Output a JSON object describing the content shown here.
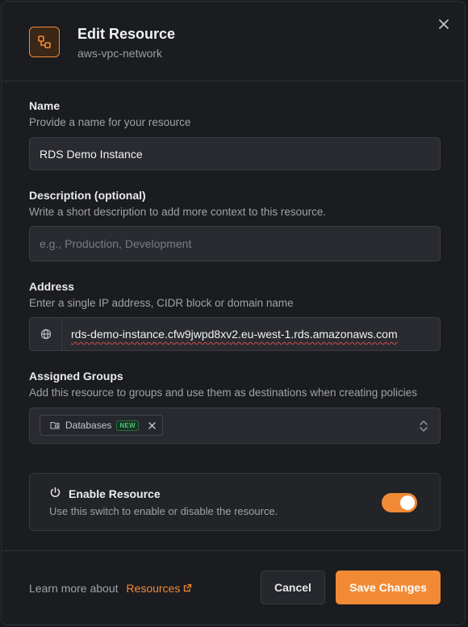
{
  "header": {
    "title": "Edit Resource",
    "subtitle": "aws-vpc-network"
  },
  "name_field": {
    "label": "Name",
    "help": "Provide a name for your resource",
    "value": "RDS Demo Instance"
  },
  "description_field": {
    "label": "Description (optional)",
    "help": "Write a short description to add more context to this resource.",
    "placeholder": "e.g., Production, Development"
  },
  "address_field": {
    "label": "Address",
    "help": "Enter a single IP address, CIDR block or domain name",
    "value": "rds-demo-instance.cfw9jwpd8xv2.eu-west-1.rds.amazonaws.com"
  },
  "groups_field": {
    "label": "Assigned Groups",
    "help": "Add this resource to groups and use them as destinations when creating policies",
    "chips": [
      {
        "label": "Databases",
        "badge": "NEW"
      }
    ]
  },
  "enable": {
    "title": "Enable Resource",
    "description": "Use this switch to enable or disable the resource.",
    "enabled": true
  },
  "footer": {
    "learn_prefix": "Learn more about",
    "learn_link": "Resources",
    "cancel_label": "Cancel",
    "save_label": "Save Changes"
  },
  "colors": {
    "accent": "#f28a35",
    "background": "#1b1c20",
    "input_bg": "#2a2b30"
  }
}
